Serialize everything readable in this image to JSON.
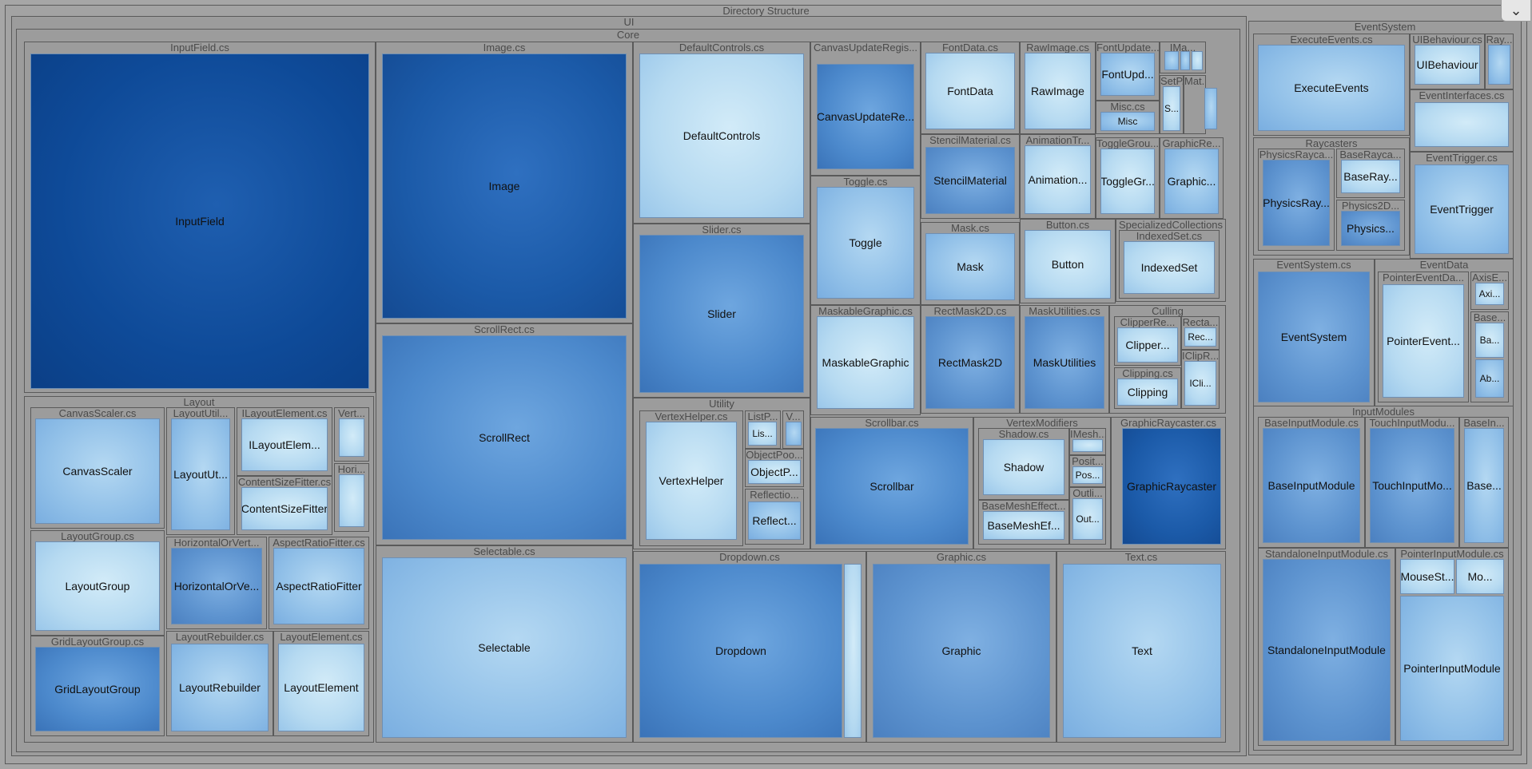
{
  "root_label": "Directory Structure",
  "collapse_icon": "chevron-down-icon",
  "palette": {
    "dark": "#0e4a98",
    "mid": "#5d93cf",
    "light": "#91c0e8",
    "vlight": "#b6daf1",
    "group_bg": "#9c9c9c"
  },
  "groups": [
    {
      "id": "ui",
      "label": "UI"
    },
    {
      "id": "core",
      "label": "Core"
    },
    {
      "id": "inputfield-cs",
      "label": "InputField.cs"
    },
    {
      "id": "image-cs",
      "label": "Image.cs"
    },
    {
      "id": "scrollrect-cs",
      "label": "ScrollRect.cs"
    },
    {
      "id": "selectable-cs",
      "label": "Selectable.cs"
    },
    {
      "id": "defaultcontrols-cs",
      "label": "DefaultControls.cs"
    },
    {
      "id": "slider-cs",
      "label": "Slider.cs"
    },
    {
      "id": "utility",
      "label": "Utility"
    },
    {
      "id": "vertexhelper-cs",
      "label": "VertexHelper.cs"
    },
    {
      "id": "listpool-cs",
      "label": "ListP..."
    },
    {
      "id": "v-cs",
      "label": "V..."
    },
    {
      "id": "objectpool-cs",
      "label": "ObjectPoo..."
    },
    {
      "id": "reflection-cs",
      "label": "Reflectio..."
    },
    {
      "id": "canvasupdateregistry-cs",
      "label": "CanvasUpdateRegis..."
    },
    {
      "id": "toggle-cs",
      "label": "Toggle.cs"
    },
    {
      "id": "maskablegraphic-cs",
      "label": "MaskableGraphic.cs"
    },
    {
      "id": "fontdata-cs",
      "label": "FontData.cs"
    },
    {
      "id": "rawimage-cs",
      "label": "RawImage.cs"
    },
    {
      "id": "fontupdate-cs",
      "label": "FontUpdate..."
    },
    {
      "id": "ima-cs",
      "label": "IMa..."
    },
    {
      "id": "misc-cs",
      "label": "Misc.cs"
    },
    {
      "id": "setp-cs",
      "label": "SetP..."
    },
    {
      "id": "mat-cs",
      "label": "Mat..."
    },
    {
      "id": "stencilmaterial-cs",
      "label": "StencilMaterial.cs"
    },
    {
      "id": "animationtr-cs",
      "label": "AnimationTr..."
    },
    {
      "id": "togglegroup-cs",
      "label": "ToggleGrou..."
    },
    {
      "id": "graphicre-cs",
      "label": "GraphicRe..."
    },
    {
      "id": "mask-cs",
      "label": "Mask.cs"
    },
    {
      "id": "button-cs",
      "label": "Button.cs"
    },
    {
      "id": "specializedcollections",
      "label": "SpecializedCollections"
    },
    {
      "id": "indexedset-cs",
      "label": "IndexedSet.cs"
    },
    {
      "id": "rectmask2d-cs",
      "label": "RectMask2D.cs"
    },
    {
      "id": "maskutilities-cs",
      "label": "MaskUtilities.cs"
    },
    {
      "id": "culling",
      "label": "Culling"
    },
    {
      "id": "clipperre-cs",
      "label": "ClipperRe..."
    },
    {
      "id": "recta-cs",
      "label": "Recta..."
    },
    {
      "id": "iclipr-cs",
      "label": "IClipR..."
    },
    {
      "id": "clipping-cs",
      "label": "Clipping.cs"
    },
    {
      "id": "scrollbar-cs",
      "label": "Scrollbar.cs"
    },
    {
      "id": "vertexmodifiers",
      "label": "VertexModifiers"
    },
    {
      "id": "shadow-cs",
      "label": "Shadow.cs"
    },
    {
      "id": "imesh-cs",
      "label": "IMesh..."
    },
    {
      "id": "posit-cs",
      "label": "Posit..."
    },
    {
      "id": "outli-cs",
      "label": "Outli..."
    },
    {
      "id": "basemesheffect-cs",
      "label": "BaseMeshEffect..."
    },
    {
      "id": "graphicraycaster-cs",
      "label": "GraphicRaycaster.cs"
    },
    {
      "id": "dropdown-cs",
      "label": "Dropdown.cs"
    },
    {
      "id": "graphic-cs",
      "label": "Graphic.cs"
    },
    {
      "id": "text-cs",
      "label": "Text.cs"
    },
    {
      "id": "layout",
      "label": "Layout"
    },
    {
      "id": "canvasscaler-cs",
      "label": "CanvasScaler.cs"
    },
    {
      "id": "layoututil-cs",
      "label": "LayoutUtil..."
    },
    {
      "id": "ilayoutelement-cs",
      "label": "ILayoutElement.cs"
    },
    {
      "id": "vert-cs",
      "label": "Vert..."
    },
    {
      "id": "hori-cs",
      "label": "Hori..."
    },
    {
      "id": "contentsizefitter-cs",
      "label": "ContentSizeFitter.cs"
    },
    {
      "id": "layoutgroup-cs",
      "label": "LayoutGroup.cs"
    },
    {
      "id": "horizontalorvert-cs",
      "label": "HorizontalOrVert..."
    },
    {
      "id": "aspectratiofitter-cs",
      "label": "AspectRatioFitter.cs"
    },
    {
      "id": "gridlayoutgroup-cs",
      "label": "GridLayoutGroup.cs"
    },
    {
      "id": "layoutrebuilder-cs",
      "label": "LayoutRebuilder.cs"
    },
    {
      "id": "layoutelement-cs",
      "label": "LayoutElement.cs"
    },
    {
      "id": "eventsystem",
      "label": "EventSystem"
    },
    {
      "id": "executeevents-cs",
      "label": "ExecuteEvents.cs"
    },
    {
      "id": "uibehaviour-cs",
      "label": "UIBehaviour.cs"
    },
    {
      "id": "ray-cs",
      "label": "Ray..."
    },
    {
      "id": "eventinterfaces-cs",
      "label": "EventInterfaces.cs"
    },
    {
      "id": "raycasters",
      "label": "Raycasters"
    },
    {
      "id": "physicsraycaster-cs",
      "label": "PhysicsRayca..."
    },
    {
      "id": "baseraycaster-cs",
      "label": "BaseRayca..."
    },
    {
      "id": "physics2d-cs",
      "label": "Physics2D..."
    },
    {
      "id": "eventtrigger-cs",
      "label": "EventTrigger.cs"
    },
    {
      "id": "eventsystem-cs",
      "label": "EventSystem.cs"
    },
    {
      "id": "eventdata",
      "label": "EventData"
    },
    {
      "id": "pointereventdata-cs",
      "label": "PointerEventDa..."
    },
    {
      "id": "axise-cs",
      "label": "AxisE..."
    },
    {
      "id": "base-cs",
      "label": "Base..."
    },
    {
      "id": "inputmodules",
      "label": "InputModules"
    },
    {
      "id": "baseinputmodule-cs",
      "label": "BaseInputModule.cs"
    },
    {
      "id": "touchinputmodule-cs",
      "label": "TouchInputModu..."
    },
    {
      "id": "basein-cs",
      "label": "BaseIn..."
    },
    {
      "id": "standaloneinputmodule-cs",
      "label": "StandaloneInputModule.cs"
    },
    {
      "id": "pointerinputmodule-cs",
      "label": "PointerInputModule.cs"
    }
  ],
  "leaves": [
    {
      "id": "inputfield",
      "label": "InputField",
      "shade": "dark"
    },
    {
      "id": "image",
      "label": "Image",
      "shade": "deep"
    },
    {
      "id": "scrollrect",
      "label": "ScrollRect",
      "shade": "blue"
    },
    {
      "id": "selectable",
      "label": "Selectable",
      "shade": "light"
    },
    {
      "id": "defaultcontrols",
      "label": "DefaultControls",
      "shade": "vlight"
    },
    {
      "id": "slider",
      "label": "Slider",
      "shade": "blue"
    },
    {
      "id": "vertexhelper",
      "label": "VertexHelper",
      "shade": "vlight"
    },
    {
      "id": "listpool",
      "label": "Lis...",
      "shade": "vlight"
    },
    {
      "id": "v-leaf",
      "label": "",
      "shade": "light"
    },
    {
      "id": "objectpool",
      "label": "ObjectP...",
      "shade": "vlight"
    },
    {
      "id": "reflection",
      "label": "Reflect...",
      "shade": "light"
    },
    {
      "id": "canvasupdateregistry",
      "label": "CanvasUpdateRe...",
      "shade": "blue"
    },
    {
      "id": "toggle",
      "label": "Toggle",
      "shade": "light"
    },
    {
      "id": "maskablegraphic",
      "label": "MaskableGraphic",
      "shade": "vlight"
    },
    {
      "id": "fontdata",
      "label": "FontData",
      "shade": "vlight"
    },
    {
      "id": "rawimage",
      "label": "RawImage",
      "shade": "vlight"
    },
    {
      "id": "fontupdate",
      "label": "FontUpd...",
      "shade": "light"
    },
    {
      "id": "ima-a",
      "label": "",
      "shade": "light"
    },
    {
      "id": "ima-b",
      "label": "",
      "shade": "light"
    },
    {
      "id": "ima-c",
      "label": "",
      "shade": "vlight"
    },
    {
      "id": "misc",
      "label": "Misc",
      "shade": "light"
    },
    {
      "id": "setp",
      "label": "S...",
      "shade": "vlight"
    },
    {
      "id": "mat",
      "label": "",
      "shade": "light"
    },
    {
      "id": "stencilmaterial",
      "label": "StencilMaterial",
      "shade": "mid"
    },
    {
      "id": "animationtr",
      "label": "Animation...",
      "shade": "vlight"
    },
    {
      "id": "togglegroup",
      "label": "ToggleGr...",
      "shade": "vlight"
    },
    {
      "id": "graphicre",
      "label": "Graphic...",
      "shade": "light"
    },
    {
      "id": "mask",
      "label": "Mask",
      "shade": "light"
    },
    {
      "id": "button",
      "label": "Button",
      "shade": "vlight"
    },
    {
      "id": "indexedset",
      "label": "IndexedSet",
      "shade": "vlight"
    },
    {
      "id": "rectmask2d",
      "label": "RectMask2D",
      "shade": "mid"
    },
    {
      "id": "maskutilities",
      "label": "MaskUtilities",
      "shade": "mid"
    },
    {
      "id": "clipperre",
      "label": "Clipper...",
      "shade": "vlight"
    },
    {
      "id": "recta",
      "label": "Rec...",
      "shade": "vlight"
    },
    {
      "id": "iclipr",
      "label": "ICli...",
      "shade": "vlight"
    },
    {
      "id": "clipping",
      "label": "Clipping",
      "shade": "vlight"
    },
    {
      "id": "scrollbar",
      "label": "Scrollbar",
      "shade": "blue"
    },
    {
      "id": "shadow",
      "label": "Shadow",
      "shade": "vlight"
    },
    {
      "id": "imesh",
      "label": "",
      "shade": "vlight"
    },
    {
      "id": "posit",
      "label": "Pos...",
      "shade": "vlight"
    },
    {
      "id": "outli",
      "label": "Out...",
      "shade": "vlight"
    },
    {
      "id": "basemesheffect",
      "label": "BaseMeshEf...",
      "shade": "vlight"
    },
    {
      "id": "graphicraycaster",
      "label": "GraphicRaycaster",
      "shade": "deep"
    },
    {
      "id": "dropdown",
      "label": "Dropdown",
      "shade": "blue"
    },
    {
      "id": "dropdown-side",
      "label": "",
      "shade": "vlight"
    },
    {
      "id": "graphic",
      "label": "Graphic",
      "shade": "mid"
    },
    {
      "id": "text",
      "label": "Text",
      "shade": "light"
    },
    {
      "id": "canvasscaler",
      "label": "CanvasScaler",
      "shade": "light"
    },
    {
      "id": "layoututil",
      "label": "LayoutUt...",
      "shade": "light"
    },
    {
      "id": "ilayoutelement",
      "label": "ILayoutElem...",
      "shade": "vlight"
    },
    {
      "id": "vert",
      "label": "",
      "shade": "vlight"
    },
    {
      "id": "hori",
      "label": "",
      "shade": "vlight"
    },
    {
      "id": "contentsizefitter",
      "label": "ContentSizeFitter",
      "shade": "vlight"
    },
    {
      "id": "layoutgroup",
      "label": "LayoutGroup",
      "shade": "vlight"
    },
    {
      "id": "horizontalorvert",
      "label": "HorizontalOrVe...",
      "shade": "mid"
    },
    {
      "id": "aspectratiofitter",
      "label": "AspectRatioFitter",
      "shade": "light"
    },
    {
      "id": "gridlayoutgroup",
      "label": "GridLayoutGroup",
      "shade": "blue"
    },
    {
      "id": "layoutrebuilder",
      "label": "LayoutRebuilder",
      "shade": "light"
    },
    {
      "id": "layoutelement",
      "label": "LayoutElement",
      "shade": "vlight"
    },
    {
      "id": "executeevents",
      "label": "ExecuteEvents",
      "shade": "light"
    },
    {
      "id": "uibehaviour",
      "label": "UIBehaviour",
      "shade": "vlight"
    },
    {
      "id": "ray",
      "label": "",
      "shade": "light"
    },
    {
      "id": "eventinterfaces",
      "label": "",
      "shade": "vlight"
    },
    {
      "id": "physicsraycaster",
      "label": "PhysicsRay...",
      "shade": "mid"
    },
    {
      "id": "baseraycaster",
      "label": "BaseRay...",
      "shade": "vlight"
    },
    {
      "id": "physics2d",
      "label": "Physics...",
      "shade": "mid"
    },
    {
      "id": "eventtrigger",
      "label": "EventTrigger",
      "shade": "light"
    },
    {
      "id": "eventsystem-leaf",
      "label": "EventSystem",
      "shade": "mid"
    },
    {
      "id": "pointereventdata",
      "label": "PointerEvent...",
      "shade": "vlight"
    },
    {
      "id": "axise",
      "label": "Axi...",
      "shade": "vlight"
    },
    {
      "id": "base-a",
      "label": "Ba...",
      "shade": "vlight"
    },
    {
      "id": "base-b",
      "label": "Ab...",
      "shade": "light"
    },
    {
      "id": "baseinputmodule",
      "label": "BaseInputModule",
      "shade": "mid"
    },
    {
      "id": "touchinputmodule",
      "label": "TouchInputMo...",
      "shade": "mid"
    },
    {
      "id": "basein",
      "label": "Base...",
      "shade": "light"
    },
    {
      "id": "standaloneinputmodule",
      "label": "StandaloneInputModule",
      "shade": "mid"
    },
    {
      "id": "mousestate",
      "label": "MouseSt...",
      "shade": "vlight"
    },
    {
      "id": "mo",
      "label": "Mo...",
      "shade": "vlight"
    },
    {
      "id": "pointerinputmodule",
      "label": "PointerInputModule",
      "shade": "light"
    }
  ]
}
